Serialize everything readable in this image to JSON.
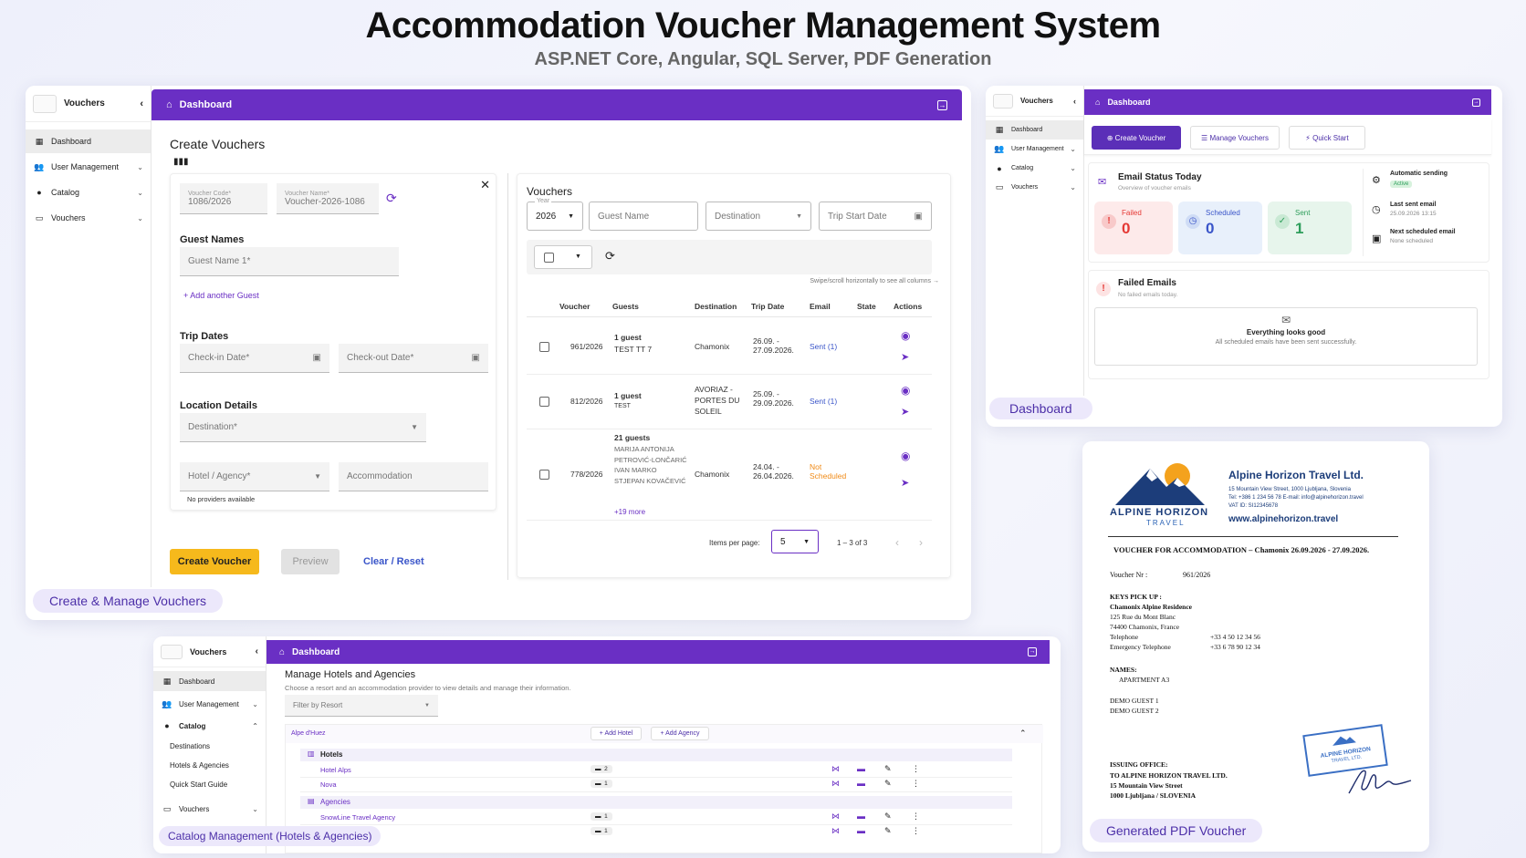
{
  "header": {
    "title": "Accommodation Voucher Management System",
    "subtitle": "ASP.NET Core, Angular, SQL Server, PDF Generation"
  },
  "colors": {
    "primary": "#6a2fc4",
    "accent_yellow": "#f6b91c",
    "failed": "#e53935",
    "scheduled": "#3a55c9",
    "sent": "#2e9e5b"
  },
  "panel1": {
    "caption": "Create & Manage Vouchers",
    "sidebar": {
      "title": "Vouchers",
      "items": [
        {
          "label": "Dashboard",
          "icon": "dashboard-icon"
        },
        {
          "label": "User Management",
          "icon": "users-icon"
        },
        {
          "label": "Catalog",
          "icon": "pin-icon"
        },
        {
          "label": "Vouchers",
          "icon": "monitor-icon"
        }
      ]
    },
    "topbar": {
      "title": "Dashboard"
    },
    "form": {
      "heading": "Create Vouchers",
      "voucher_code_label": "Voucher Code*",
      "voucher_code": "1086/2026",
      "voucher_name_label": "Voucher Name*",
      "voucher_name": "Voucher-2026-1086",
      "guest_names_title": "Guest Names",
      "guest_name_placeholder": "Guest Name 1*",
      "add_guest": "+ Add another Guest",
      "trip_dates_title": "Trip Dates",
      "checkin_placeholder": "Check-in Date*",
      "checkout_placeholder": "Check-out Date*",
      "location_title": "Location Details",
      "destination_placeholder": "Destination*",
      "hotel_placeholder": "Hotel / Agency*",
      "accommodation_placeholder": "Accommodation",
      "no_providers": "No providers available",
      "create_btn": "Create Voucher",
      "preview_btn": "Preview",
      "clear_btn": "Clear / Reset"
    },
    "vouchers": {
      "title": "Vouchers",
      "year_label": "Year",
      "year": "2026",
      "guest_name_placeholder": "Guest Name",
      "destination_placeholder": "Destination",
      "trip_start_placeholder": "Trip Start Date",
      "scroll_hint": "Swipe/scroll horizontally to see all columns",
      "columns": [
        "Voucher",
        "Guests",
        "Destination",
        "Trip Date",
        "Email",
        "State",
        "Actions"
      ],
      "rows": [
        {
          "voucher": "961/2026",
          "guests_count": "1 guest",
          "guests": "TEST TT 7",
          "destination": "Chamonix",
          "trip_date": "26.09. - 27.09.2026.",
          "email": "Sent (1)"
        },
        {
          "voucher": "812/2026",
          "guests_count": "1 guest",
          "guests": "TEST",
          "destination": "AVORIAZ - PORTES DU SOLEIL",
          "trip_date": "25.09. - 29.09.2026.",
          "email": "Sent (1)"
        },
        {
          "voucher": "778/2026",
          "guests_count": "21 guests",
          "guests": "MARIJA ANTONIJA PETROVIĆ-LONČARIĆ IVAN MARKO STJEPAN KOVAČEVIĆ",
          "more": "+19 more",
          "destination": "Chamonix",
          "trip_date": "24.04. - 26.04.2026.",
          "email": "Not Scheduled"
        }
      ],
      "items_per_page_label": "Items per page:",
      "items_per_page": "5",
      "range": "1 – 3 of 3"
    }
  },
  "panel2": {
    "caption": "Dashboard",
    "sidebar": {
      "title": "Vouchers",
      "items": [
        "Dashboard",
        "User Management",
        "Catalog",
        "Vouchers"
      ]
    },
    "topbar": {
      "title": "Dashboard"
    },
    "buttons": {
      "create": "Create Voucher",
      "manage": "Manage Vouchers",
      "quick": "Quick Start"
    },
    "email_status": {
      "title": "Email Status Today",
      "subtitle": "Overview of voucher emails",
      "failed_label": "Failed",
      "failed": "0",
      "scheduled_label": "Scheduled",
      "scheduled": "0",
      "sent_label": "Sent",
      "sent": "1"
    },
    "side": {
      "auto_label": "Automatic sending",
      "auto_badge": "Active",
      "last_label": "Last sent email",
      "last_value": "25.09.2026 13:15",
      "next_label": "Next scheduled email",
      "next_value": "None scheduled"
    },
    "failed_emails": {
      "title": "Failed Emails",
      "subtitle": "No failed emails today.",
      "empty_title": "Everything looks good",
      "empty_sub": "All scheduled emails have been sent successfully."
    }
  },
  "panel3": {
    "caption": "Catalog Management (Hotels & Agencies)",
    "sidebar": {
      "title": "Vouchers",
      "items": [
        "Dashboard",
        "User Management",
        "Catalog",
        "Vouchers"
      ],
      "sub": [
        "Destinations",
        "Hotels & Agencies",
        "Quick Start Guide"
      ]
    },
    "topbar": {
      "title": "Dashboard"
    },
    "heading": "Manage Hotels and Agencies",
    "description": "Choose a resort and an accommodation provider to view details and manage their information.",
    "filter_placeholder": "Filter by Resort",
    "resort": "Alpe d'Huez",
    "add_hotel": "+ Add Hotel",
    "add_agency": "+ Add Agency",
    "hotels_title": "Hotels",
    "hotels": [
      {
        "name": "Hotel Alps",
        "count": "2"
      },
      {
        "name": "Nova",
        "count": "1"
      }
    ],
    "agencies_title": "Agencies",
    "agencies": [
      {
        "name": "SnowLine Travel Agency",
        "count": "1"
      },
      {
        "name": "",
        "count": "1"
      }
    ]
  },
  "panel4": {
    "caption": "Generated PDF Voucher",
    "company": "Alpine Horizon Travel Ltd.",
    "address": "15 Mountain View Street, 1000 Ljubljana, Slovenia",
    "contact": "Tel: +386 1 234 56 78   E-mail: info@alpinehorizon.travel",
    "vat": "VAT ID: SI12345678",
    "web": "www.alpinehorizon.travel",
    "logo_line1": "ALPINE HORIZON",
    "logo_line2": "TRAVEL",
    "voucher_title": "VOUCHER FOR ACCOMMODATION – Chamonix 26.09.2026 - 27.09.2026.",
    "voucher_nr_label": "Voucher Nr :",
    "voucher_nr": "961/2026",
    "keys_label": "KEYS PICK UP :",
    "keys_name": "Chamonix Alpine Residence",
    "keys_addr1": "125 Rue du Mont Blanc",
    "keys_addr2": "74400 Chamonix, France",
    "tel_label": "Telephone",
    "tel": "+33 4 50 12 34 56",
    "emerg_label": "Emergency Telephone",
    "emerg": "+33 6 78 90 12 34",
    "names_label": "NAMES:",
    "apartment": "APARTMENT A3",
    "guest1": "DEMO GUEST 1",
    "guest2": "DEMO GUEST 2",
    "issuing_label": "ISSUING OFFICE:",
    "issuing1": "TO ALPINE HORIZON TRAVEL LTD.",
    "issuing2": "15 Mountain View Street",
    "issuing3": "1000 Ljubljana / SLOVENIA",
    "stamp_line1": "ALPINE HORIZON",
    "stamp_line2": "TRAVEL LTD."
  }
}
